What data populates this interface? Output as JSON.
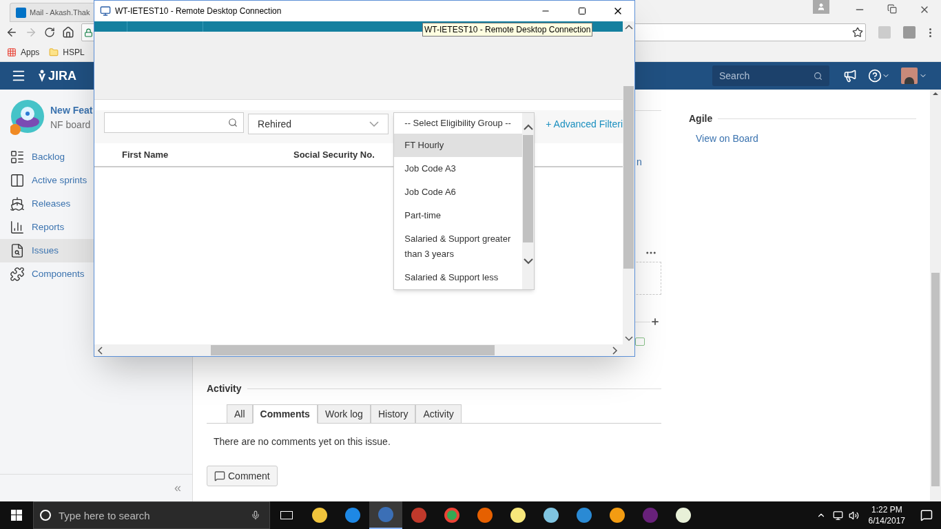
{
  "browser": {
    "tab_title": "Mail - Akash.Thak",
    "bookmarks": [
      {
        "label": "Apps"
      },
      {
        "label": "HSPL"
      }
    ]
  },
  "jira": {
    "logo": "JIRA",
    "search": {
      "placeholder": "Search"
    },
    "project": {
      "name": "New Feat",
      "board": "NF board"
    },
    "sidebar": [
      {
        "label": "Backlog",
        "kind": "backlog",
        "selected": false
      },
      {
        "label": "Active sprints",
        "kind": "sprints",
        "selected": false
      },
      {
        "label": "Releases",
        "kind": "releases",
        "selected": false
      },
      {
        "label": "Reports",
        "kind": "reports",
        "selected": false
      },
      {
        "label": "Issues",
        "kind": "issues",
        "selected": true
      },
      {
        "label": "Components",
        "kind": "components",
        "selected": false
      }
    ],
    "collapse": "«",
    "link_fragment": "n",
    "agile": {
      "heading": "Agile",
      "link": "View on Board"
    },
    "activity": {
      "heading": "Activity",
      "tabs": [
        {
          "label": "All",
          "selected": false
        },
        {
          "label": "Comments",
          "selected": true
        },
        {
          "label": "Work log",
          "selected": false
        },
        {
          "label": "History",
          "selected": false
        },
        {
          "label": "Activity",
          "selected": false
        }
      ],
      "empty_message": "There are no comments yet on this issue.",
      "comment_button": "Comment"
    }
  },
  "rdp": {
    "title": "WT-IETEST10 - Remote Desktop Connection",
    "tooltip": "WT-IETEST10 - Remote Desktop Connection",
    "status_filter": "Rehired",
    "eligibility": {
      "placeholder": "-- Select Eligibility Group --",
      "options": [
        {
          "label": "FT Hourly",
          "selected": true
        },
        {
          "label": "Job Code A3",
          "selected": false
        },
        {
          "label": "Job Code A6",
          "selected": false
        },
        {
          "label": "Part-time",
          "selected": false
        },
        {
          "label": "Salaried & Support greater than 3 years",
          "selected": false
        },
        {
          "label": "Salaried & Support less",
          "selected": false
        }
      ]
    },
    "advanced_link": "+ Advanced Filteri",
    "columns": [
      "First Name",
      "Social Security No."
    ]
  },
  "taskbar": {
    "search_placeholder": "Type here to search",
    "time": "1:22 PM",
    "date": "6/14/2017"
  }
}
